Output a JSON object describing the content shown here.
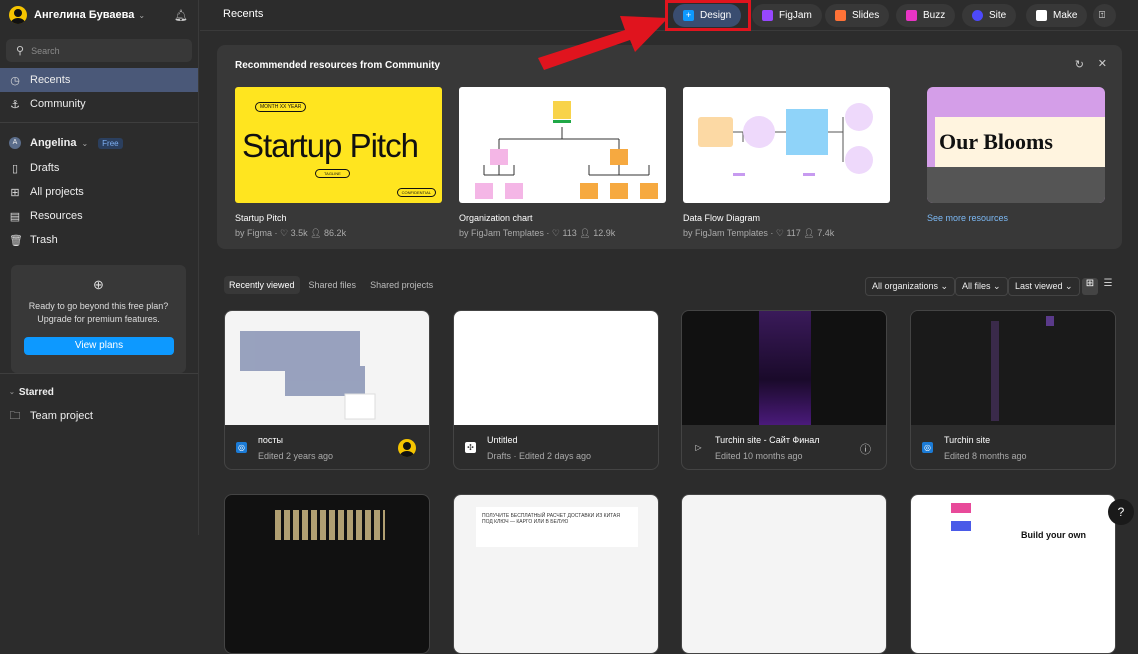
{
  "sidebar": {
    "user_name": "Ангелина Буваева",
    "search_placeholder": "Search",
    "nav": [
      {
        "label": "Recents",
        "icon": "clock-icon"
      },
      {
        "label": "Community",
        "icon": "community-icon"
      }
    ],
    "team": {
      "name": "Angelina",
      "initial": "A",
      "plan": "Free"
    },
    "team_nav": [
      {
        "label": "Drafts",
        "icon": "file-icon"
      },
      {
        "label": "All projects",
        "icon": "grid-icon"
      },
      {
        "label": "Resources",
        "icon": "resources-icon"
      },
      {
        "label": "Trash",
        "icon": "trash-icon"
      }
    ],
    "upgrade": {
      "line1": "Ready to go beyond this free plan?",
      "line2": "Upgrade for premium features.",
      "button": "View plans"
    },
    "starred": {
      "label": "Starred",
      "items": [
        "Team project"
      ]
    }
  },
  "header": {
    "title": "Recents",
    "create": [
      {
        "label": "Design",
        "color": "#0d99ff"
      },
      {
        "label": "FigJam",
        "color": "#9747ff"
      },
      {
        "label": "Slides",
        "color": "#ff7237"
      },
      {
        "label": "Buzz",
        "color": "#e834c4"
      },
      {
        "label": "Site",
        "color": "#4d49fc"
      },
      {
        "label": "Make",
        "color": "#ffffff"
      }
    ]
  },
  "community": {
    "title": "Recommended resources from Community",
    "see_more": "See more resources",
    "items": [
      {
        "title": "Startup Pitch",
        "author": "by Figma",
        "likes": "3.5k",
        "users": "86.2k",
        "thumb_text": "Startup Pitch",
        "thumb_small": [
          "MONTH XX YEAR",
          "TAGLINE",
          "CONFIDENTIAL"
        ]
      },
      {
        "title": "Organization chart",
        "author": "by FigJam Templates",
        "likes": "113",
        "users": "12.9k"
      },
      {
        "title": "Data Flow Diagram",
        "author": "by FigJam Templates",
        "likes": "117",
        "users": "7.4k"
      }
    ],
    "extra_thumb_text": "Our Blooms"
  },
  "files": {
    "tabs": [
      "Recently viewed",
      "Shared files",
      "Shared projects"
    ],
    "filters": [
      "All organizations",
      "All files",
      "Last viewed"
    ],
    "items": [
      {
        "title": "посты",
        "meta": "Edited 2 years ago"
      },
      {
        "title": "Untitled",
        "meta": "Drafts · Edited 2 days ago"
      },
      {
        "title": "Turchin site - Сайт Финал",
        "meta": "Edited 10 months ago"
      },
      {
        "title": "Turchin site",
        "meta": "Edited 8 months ago"
      }
    ],
    "row2_text": [
      "ПОЛУЧИТЕ БЕСПЛАТНЫЙ РАСЧЕТ ДОСТАВКИ ИЗ КИТАЯ ПОД КЛЮЧ — КАРГО ИЛИ В БЕЛУЮ",
      "Build your own"
    ]
  },
  "help": "?"
}
